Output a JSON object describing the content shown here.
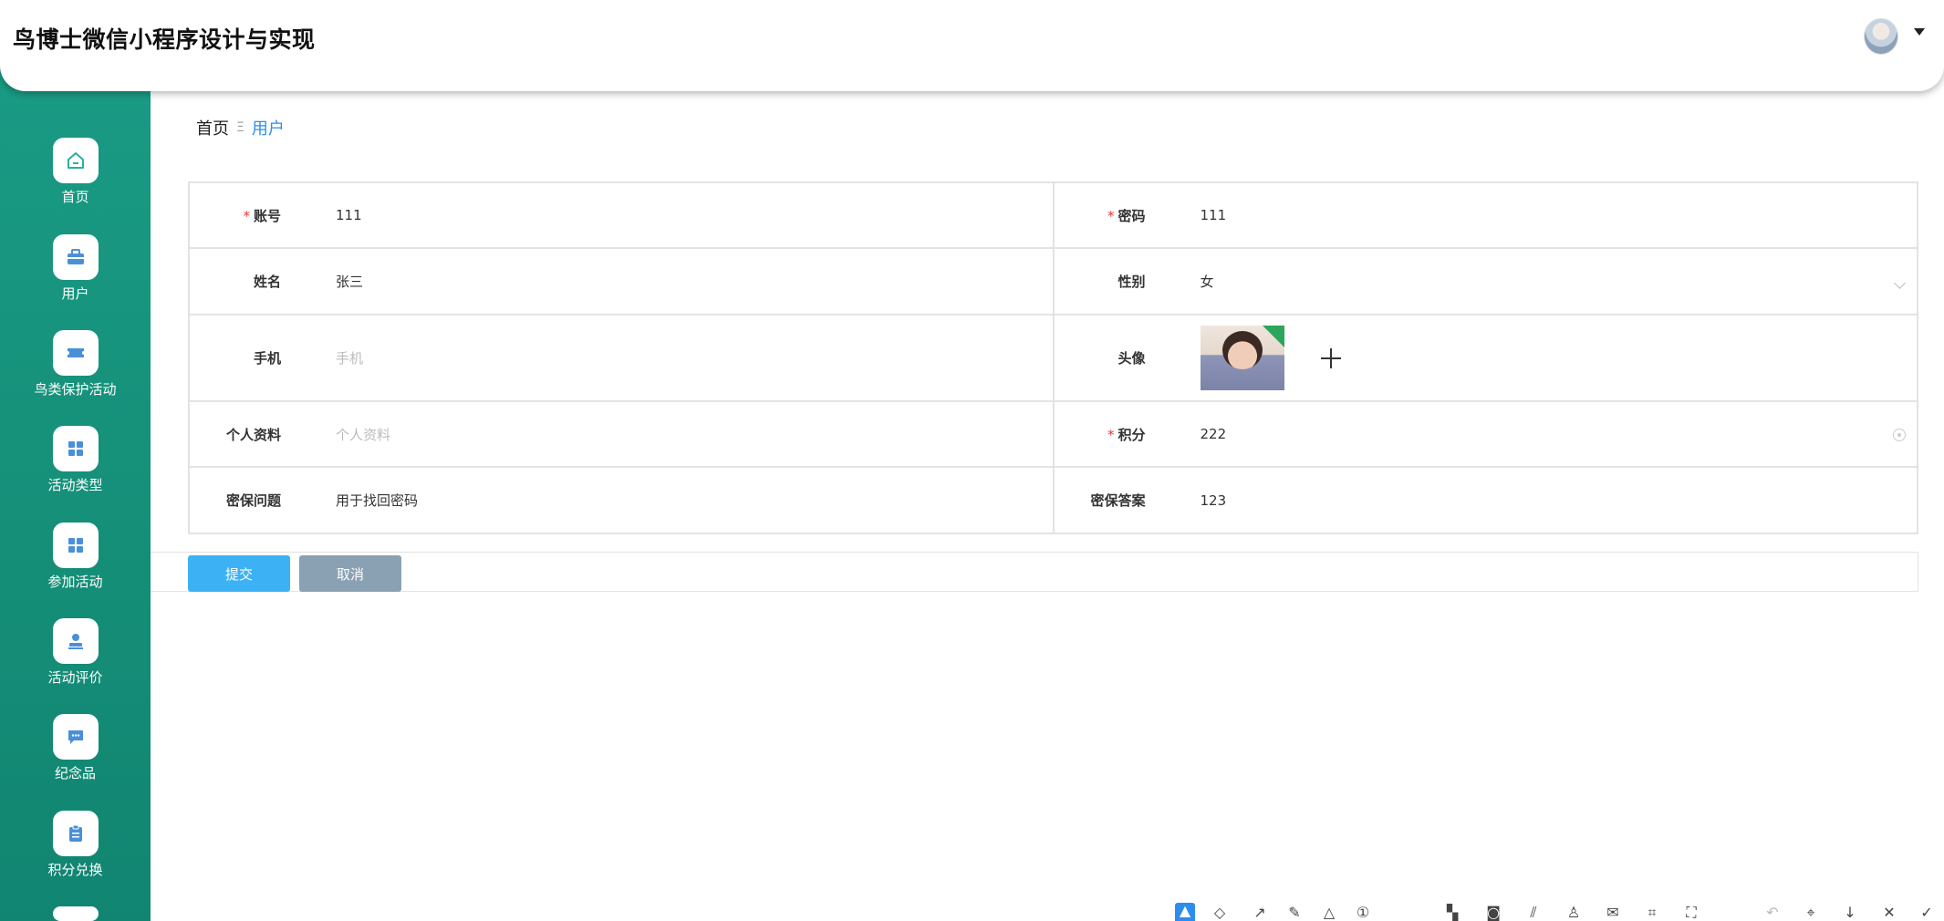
{
  "app": {
    "title": "鸟博士微信小程序设计与实现"
  },
  "sidebar": {
    "items": [
      {
        "label": "首页",
        "icon": "home-icon"
      },
      {
        "label": "用户",
        "icon": "briefcase-icon"
      },
      {
        "label": "鸟类保护活动",
        "icon": "ticket-icon"
      },
      {
        "label": "活动类型",
        "icon": "grid-icon"
      },
      {
        "label": "参加活动",
        "icon": "grid-icon"
      },
      {
        "label": "活动评价",
        "icon": "stamp-icon"
      },
      {
        "label": "纪念品",
        "icon": "chat-icon"
      },
      {
        "label": "积分兑换",
        "icon": "clipboard-icon"
      }
    ]
  },
  "breadcrumb": {
    "home": "首页",
    "separator": "Ξ",
    "current": "用户"
  },
  "form": {
    "account": {
      "label": "账号",
      "required": "*",
      "value": "111"
    },
    "password": {
      "label": "密码",
      "required": "*",
      "value": "111"
    },
    "name": {
      "label": "姓名",
      "value": "张三"
    },
    "gender": {
      "label": "性别",
      "value": "女"
    },
    "phone": {
      "label": "手机",
      "placeholder": "手机"
    },
    "avatar": {
      "label": "头像"
    },
    "profile": {
      "label": "个人资料",
      "placeholder": "个人资料"
    },
    "points": {
      "label": "积分",
      "required": "*",
      "value": "222"
    },
    "question": {
      "label": "密保问题",
      "value": "用于找回密码"
    },
    "answer": {
      "label": "密保答案",
      "value": "123"
    }
  },
  "actions": {
    "submit": "提交",
    "cancel": "取消"
  },
  "colors": {
    "sidebar": "#16917a",
    "accent": "#2d8cf0",
    "submit": "#3cb2f5",
    "cancel": "#8aa1b4",
    "required": "#e33333"
  }
}
